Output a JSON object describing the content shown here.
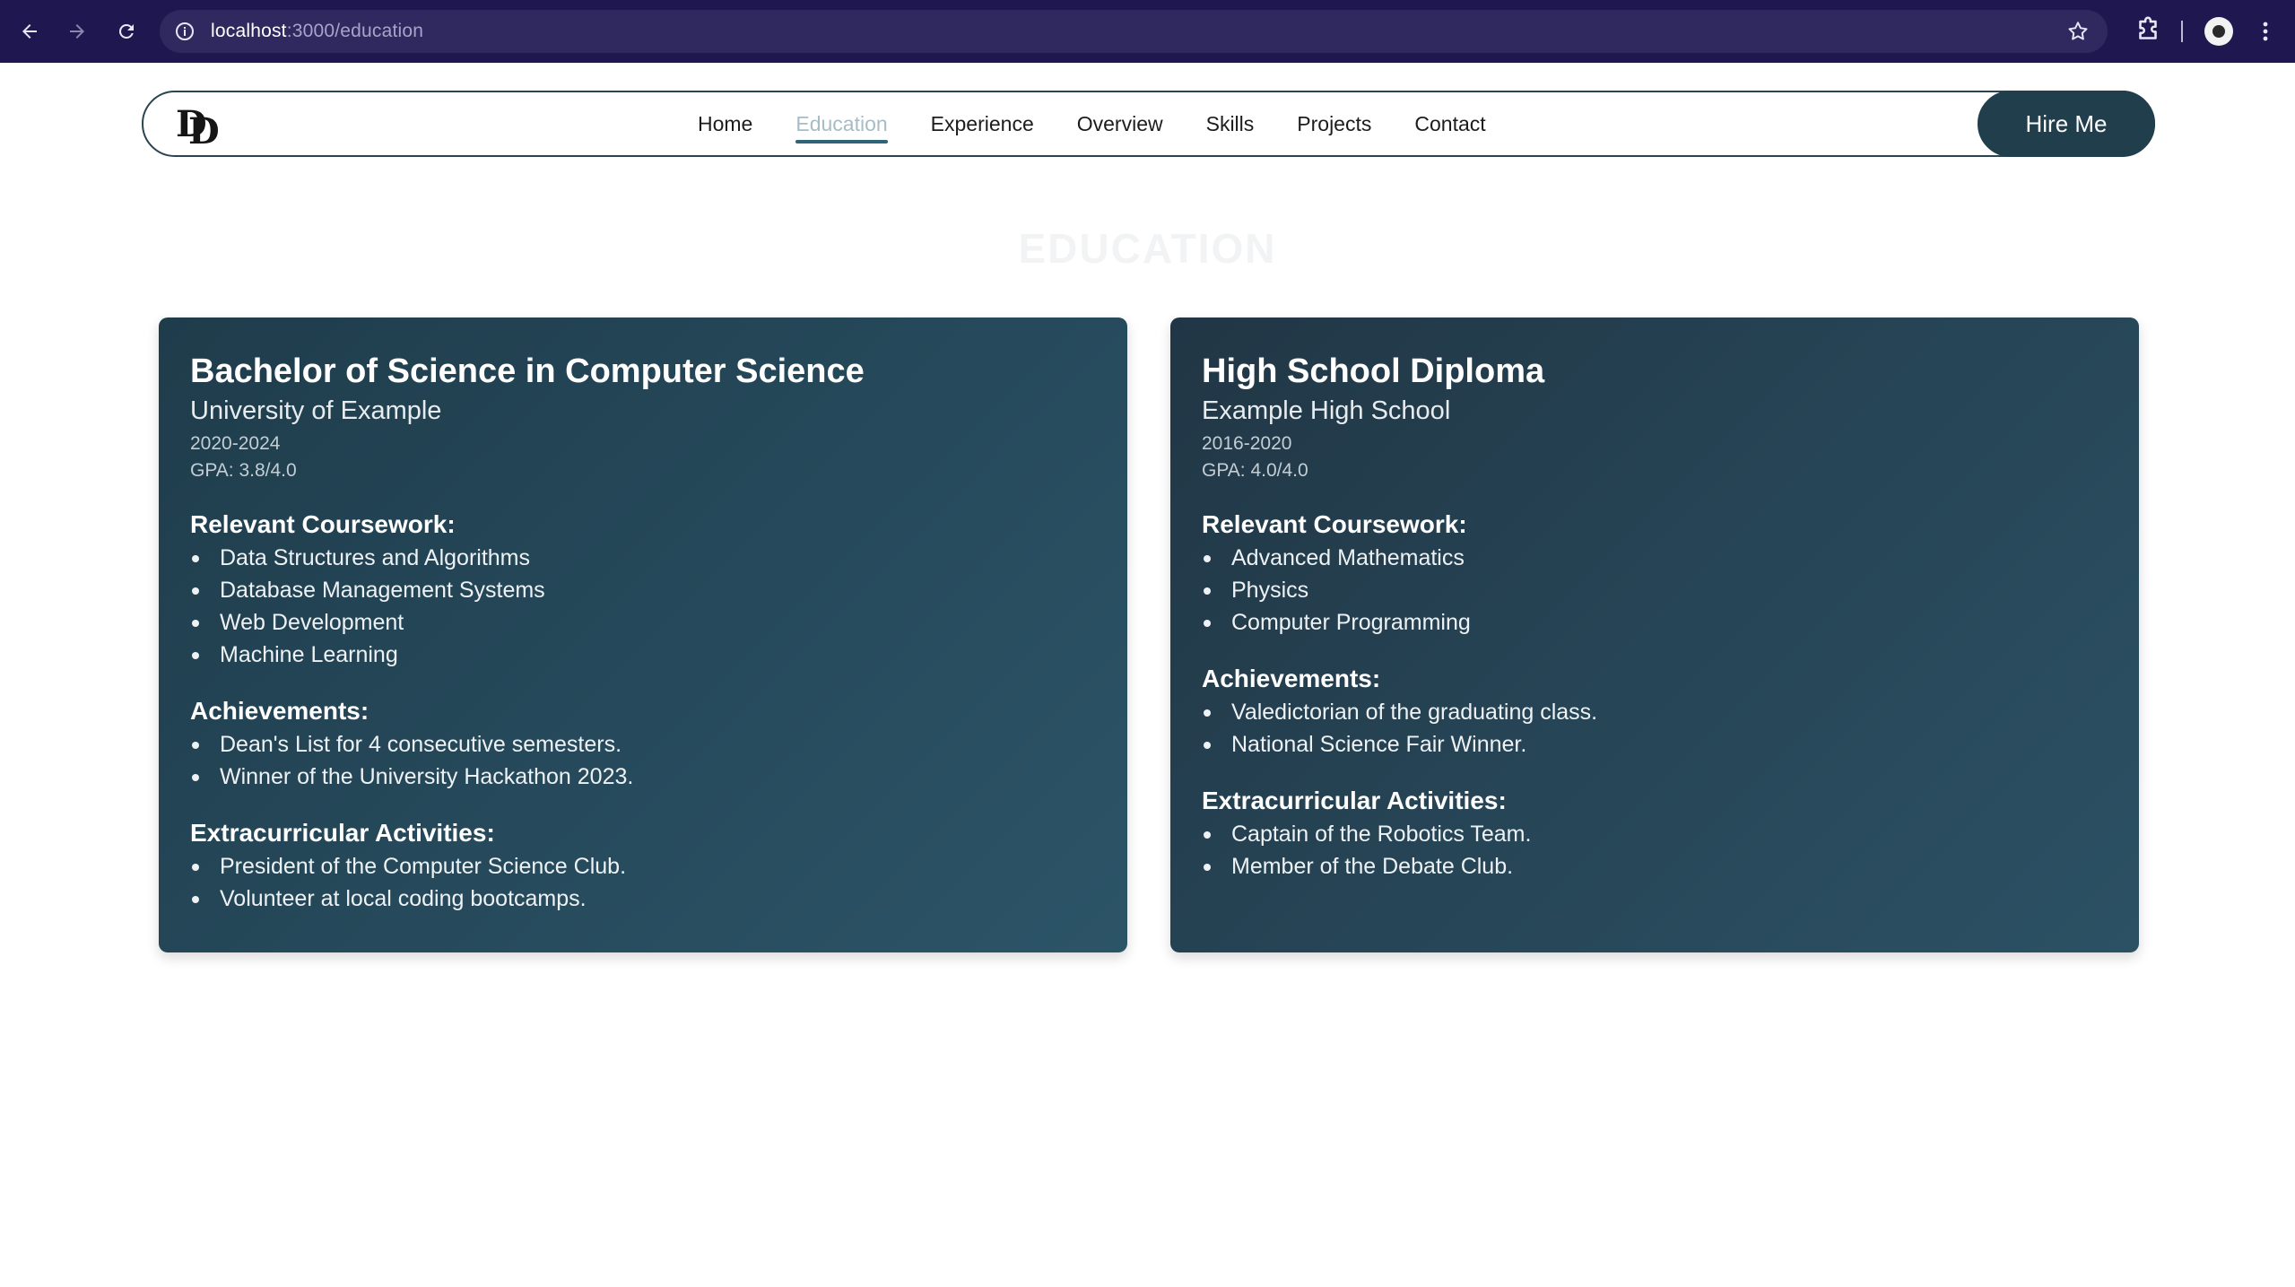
{
  "browser": {
    "url_host": "localhost",
    "url_path": ":3000/education"
  },
  "navbar": {
    "logo_text_1": "D",
    "logo_text_2": "D",
    "links": [
      "Home",
      "Education",
      "Experience",
      "Overview",
      "Skills",
      "Projects",
      "Contact"
    ],
    "active": "Education",
    "cta": "Hire Me"
  },
  "section": {
    "title": "EDUCATION"
  },
  "cards": [
    {
      "degree": "Bachelor of Science in Computer Science",
      "school": "University of Example",
      "years": "2020-2024",
      "gpa": "GPA: 3.8/4.0",
      "coursework_heading": "Relevant Coursework:",
      "coursework": [
        "Data Structures and Algorithms",
        "Database Management Systems",
        "Web Development",
        "Machine Learning"
      ],
      "achievements_heading": "Achievements:",
      "achievements": [
        "Dean's List for 4 consecutive semesters.",
        "Winner of the University Hackathon 2023."
      ],
      "activities_heading": "Extracurricular Activities:",
      "activities": [
        "President of the Computer Science Club.",
        "Volunteer at local coding bootcamps."
      ]
    },
    {
      "degree": "High School Diploma",
      "school": "Example High School",
      "years": "2016-2020",
      "gpa": "GPA: 4.0/4.0",
      "coursework_heading": "Relevant Coursework:",
      "coursework": [
        "Advanced Mathematics",
        "Physics",
        "Computer Programming"
      ],
      "achievements_heading": "Achievements:",
      "achievements": [
        "Valedictorian of the graduating class.",
        "National Science Fair Winner."
      ],
      "activities_heading": "Extracurricular Activities:",
      "activities": [
        "Captain of the Robotics Team.",
        "Member of the Debate Club."
      ]
    }
  ]
}
